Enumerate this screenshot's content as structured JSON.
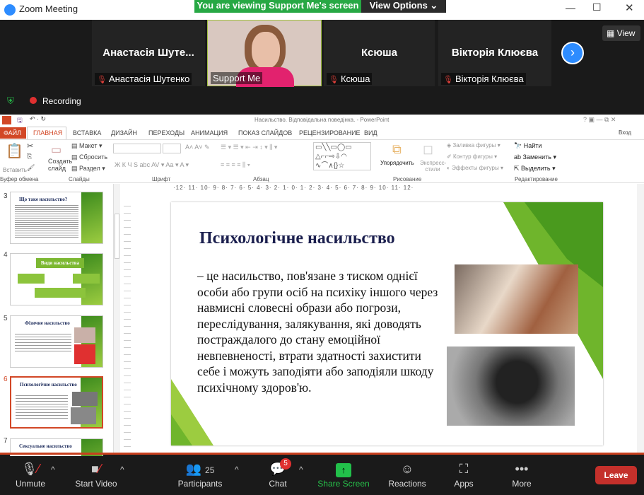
{
  "zoom": {
    "title": "Zoom Meeting",
    "banner": "You are viewing Support Me's screen",
    "view_options": "View Options",
    "view_button": "View",
    "recording": "Recording",
    "participants": [
      {
        "display": "Анастасія Шуте...",
        "name": "Анастасія Шутенко"
      },
      {
        "display": "",
        "name": "Support Me"
      },
      {
        "display": "Ксюша",
        "name": "Ксюша"
      },
      {
        "display": "Вікторія Клюєва",
        "name": "Вікторія Клюєва"
      }
    ],
    "toolbar": {
      "unmute": "Unmute",
      "start_video": "Start Video",
      "participants": "Participants",
      "participant_count": "25",
      "chat": "Chat",
      "chat_badge": "5",
      "share": "Share Screen",
      "reactions": "Reactions",
      "apps": "Apps",
      "more": "More",
      "leave": "Leave"
    }
  },
  "ppt": {
    "title": "Насильство. Відповідальна поведінка. - PowerPoint",
    "signin": "Вход",
    "tabs": [
      "ФАЙЛ",
      "ГЛАВНАЯ",
      "ВСТАВКА",
      "ДИЗАЙН",
      "ПЕРЕХОДЫ",
      "АНИМАЦИЯ",
      "ПОКАЗ СЛАЙДОВ",
      "РЕЦЕНЗИРОВАНИЕ",
      "ВИД"
    ],
    "ribbon": {
      "paste": "Вставить",
      "new_slide": "Создать слайд",
      "layout": "Макет",
      "reset": "Сбросить",
      "section": "Раздел",
      "arrange": "Упорядочить",
      "quick_styles": "Экспресс-стили",
      "fill": "Заливка фигуры",
      "outline": "Контур фигуры",
      "effects": "Эффекты фигуры",
      "find": "Найти",
      "replace": "Заменить",
      "select": "Выделить",
      "groups": [
        "Буфер обмена",
        "Слайды",
        "Шрифт",
        "Абзац",
        "Рисование",
        "Редактирование"
      ]
    },
    "ruler": "·12· 11· 10· 9· 8· 7· 6· 5· 4· 3· 2· 1· 0· 1· 2· 3· 4· 5· 6· 7· 8· 9· 10· 11· 12·",
    "thumbnails": [
      {
        "num": "3",
        "title": "Що таке насильство?"
      },
      {
        "num": "4",
        "title": "Види насильства"
      },
      {
        "num": "5",
        "title": "Фізичне насильство"
      },
      {
        "num": "6",
        "title": "Психологічне насильство"
      },
      {
        "num": "7",
        "title": "Сексуальне насильство"
      }
    ],
    "slide": {
      "title": "Психологічне насильство",
      "body": "– це насильство, пов'язане з тиском однієї особи або групи осіб на психіку іншого через навмисні словесні образи або погрози, переслідування, залякування, які доводять постраждалого до стану емоційної невпевненості, втрати здатності захистити себе і можуть заподіяти або заподіяли шкоду психічному здоров'ю."
    }
  },
  "colors": {
    "accent_green": "#27a844",
    "ppt_red": "#d24726",
    "leave": "#c4302b"
  }
}
